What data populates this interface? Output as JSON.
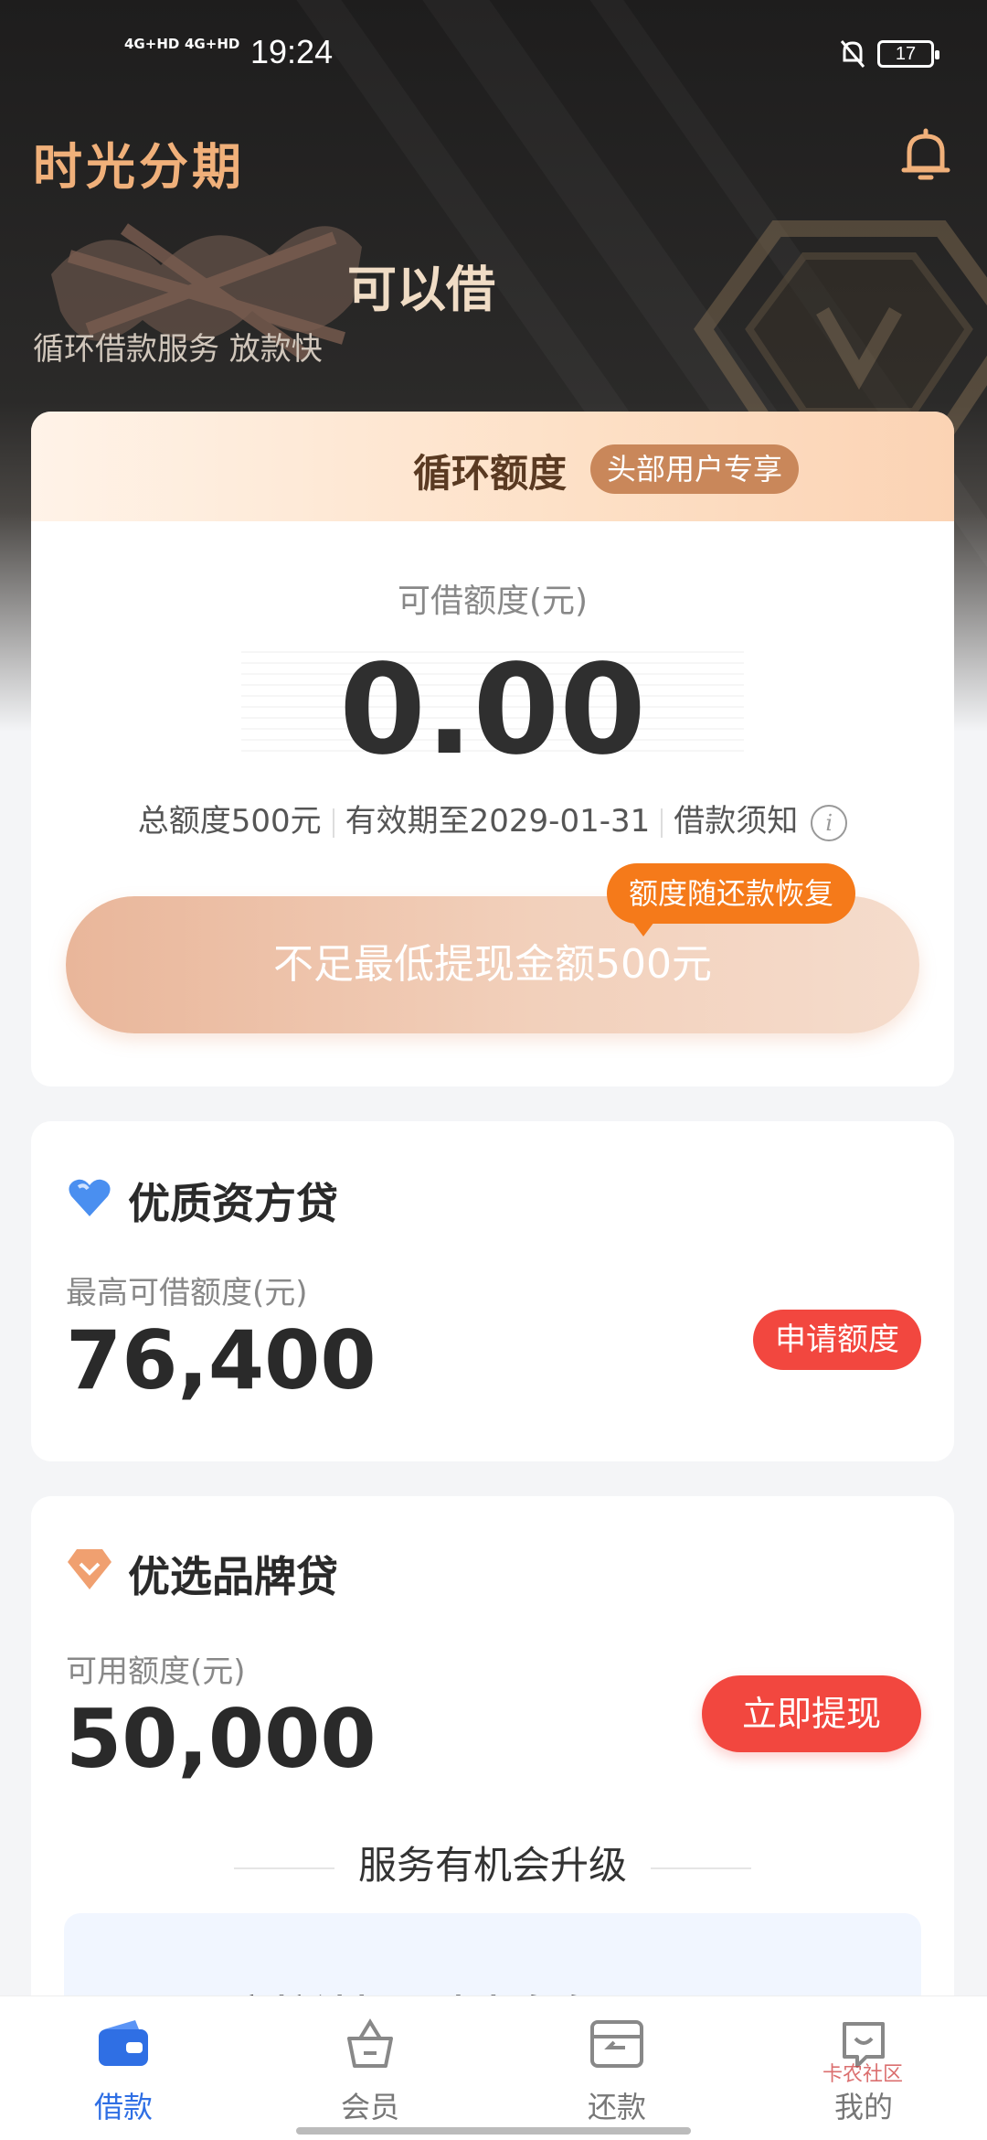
{
  "status_bar": {
    "signal1": "4G+HD",
    "signal2": "4G+HD",
    "time": "19:24",
    "battery": "17"
  },
  "hero": {
    "brand": "时光分期",
    "title": "可以借",
    "subtitle": "循环借款服务 放款快"
  },
  "credit_card": {
    "header_title": "循环额度",
    "header_tag": "头部用户专享",
    "available_label": "可借额度(元)",
    "available_amount": "0.00",
    "total_limit": "总额度500元",
    "valid_until": "有效期至2029-01-31",
    "notice": "借款须知",
    "recover_tag": "额度随还款恢复",
    "withdraw_button": "不足最低提现金额500元"
  },
  "product1": {
    "title": "优质资方贷",
    "label": "最高可借额度(元)",
    "amount": "76,400",
    "button": "申请额度"
  },
  "product2": {
    "title": "优选品牌贷",
    "label": "可用额度(元)",
    "amount": "50,000",
    "button": "立即提现",
    "section_title": "服务有机会升级",
    "upgrade_text": "审核被拒？速查自身…"
  },
  "tabbar": {
    "tabs": [
      {
        "label": "借款",
        "icon": "wallet-icon",
        "active": true
      },
      {
        "label": "会员",
        "icon": "member-basket-icon",
        "active": false
      },
      {
        "label": "还款",
        "icon": "repay-card-icon",
        "active": false
      },
      {
        "label": "我的",
        "icon": "profile-icon",
        "active": false
      }
    ]
  },
  "watermark": "卡农社区",
  "colors": {
    "accent_orange": "#f57a1a",
    "cta_red": "#f2473f",
    "active_blue": "#2f6fe4",
    "brand_gold": "#f0b07a"
  }
}
